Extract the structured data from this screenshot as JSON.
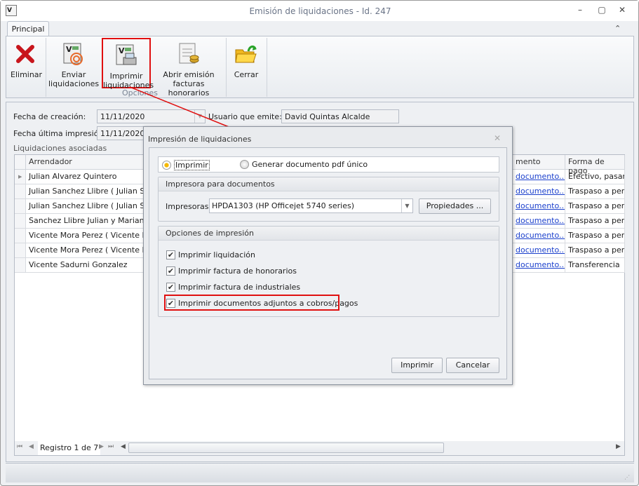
{
  "window": {
    "title": "Emisión de liquidaciones - Id. 247",
    "minimize": "–",
    "maximize": "▢",
    "close": "✕"
  },
  "ribbon": {
    "tab": "Principal",
    "collapse": "⌃",
    "group_label": "Opciones",
    "buttons": [
      {
        "label1": "Eliminar",
        "label2": "",
        "icon": "delete-x-icon"
      },
      {
        "label1": "Enviar",
        "label2": "liquidaciones",
        "icon": "send-documents-icon"
      },
      {
        "label1": "Imprimir",
        "label2": "liquidaciones",
        "icon": "print-documents-icon"
      },
      {
        "label1": "Abrir emisión",
        "label2": "facturas honorarios",
        "icon": "invoice-coins-icon"
      },
      {
        "label1": "Cerrar",
        "label2": "",
        "icon": "folder-exit-icon"
      }
    ]
  },
  "form": {
    "fecha_creacion_label": "Fecha de creación:",
    "fecha_creacion": "11/11/2020",
    "usuario_label": "Usuario que emite:",
    "usuario": "David Quintas Alcalde",
    "fecha_impresion_label": "Fecha última impresión:",
    "fecha_impresion": "11/11/2020",
    "grid_label": "Liquidaciones asociadas"
  },
  "grid": {
    "columns": [
      "Arrendador",
      "mento",
      "Forma de pago"
    ],
    "rows": [
      [
        "Julian Alvarez Quintero",
        "documento...",
        "Efectivo, pasan p"
      ],
      [
        "Julian Sanchez Llibre ( Julian Sanch",
        "documento...",
        "Traspaso a perce"
      ],
      [
        "Julian Sanchez Llibre ( Julian Sanch",
        "documento...",
        "Traspaso a perce"
      ],
      [
        "Sanchez Llibre Julian y Mariano C.B",
        "documento...",
        "Traspaso a perce"
      ],
      [
        "Vicente Mora Perez ( Vicente Mora",
        "documento...",
        "Traspaso a perce"
      ],
      [
        "Vicente Mora Perez ( Vicente Mora",
        "documento...",
        "Traspaso a perce"
      ],
      [
        "Vicente Sadurni Gonzalez",
        "documento...",
        "Transferencia"
      ]
    ],
    "record": "Registro 1 de 7"
  },
  "dialog": {
    "title": "Impresión de liquidaciones",
    "close": "✕",
    "radio_print": "Imprimir",
    "radio_pdf": "Generar documento pdf único",
    "selected": "Imprimir",
    "printer_group": "Impresora para documentos",
    "printer_label": "Impresoras:",
    "printer_value": "HPDA1303 (HP Officejet 5740 series)",
    "properties": "Propiedades ...",
    "options_group": "Opciones de impresión",
    "options": [
      {
        "label": "Imprimir liquidación",
        "checked": true
      },
      {
        "label": "Imprimir factura de honorarios",
        "checked": true
      },
      {
        "label": "Imprimir factura de industriales",
        "checked": true
      },
      {
        "label": "Imprimir documentos adjuntos a cobros/pagos",
        "checked": true
      }
    ],
    "ok": "Imprimir",
    "cancel": "Cancelar"
  },
  "colors": {
    "highlight": "#e01010",
    "link": "#1a3fcc",
    "radio_selected": "#f5b800"
  }
}
